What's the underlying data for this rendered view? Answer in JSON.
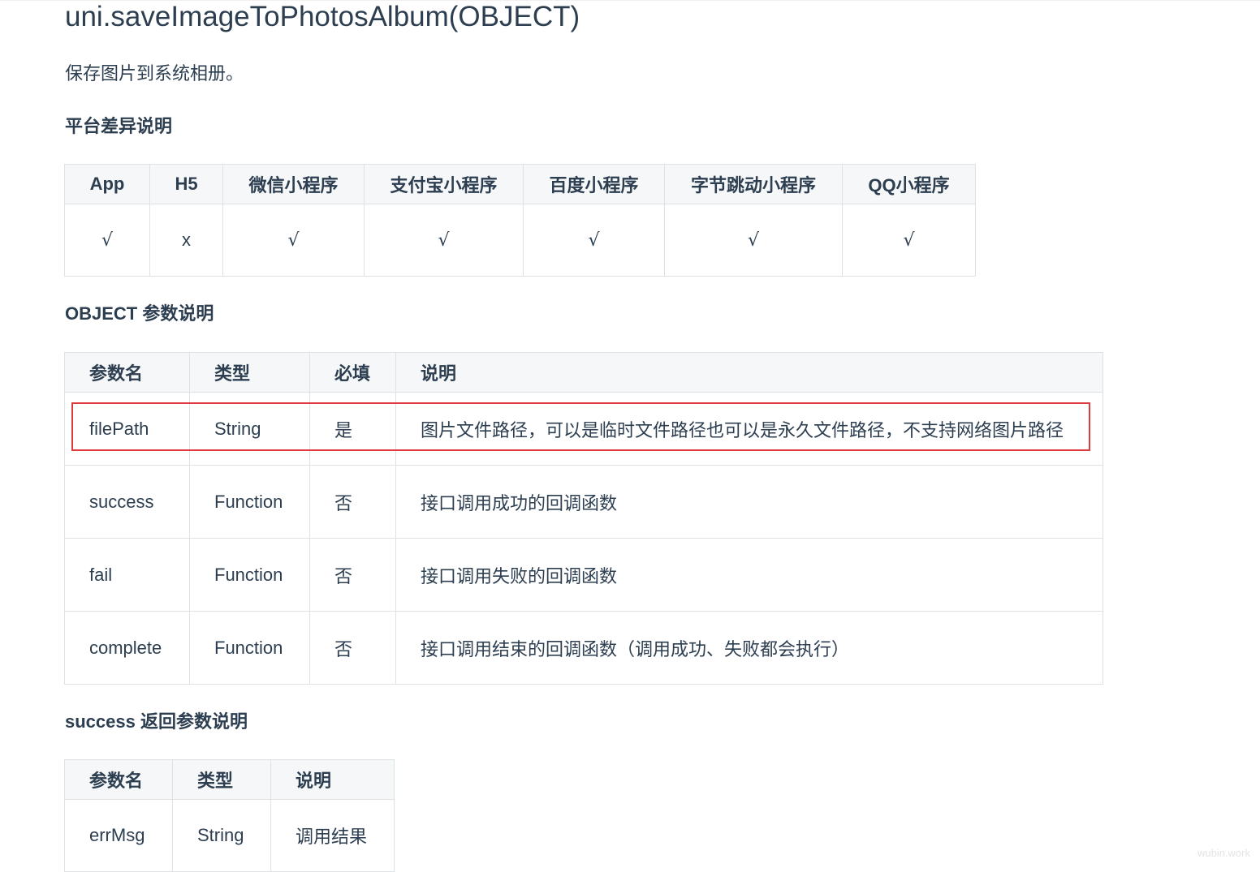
{
  "page": {
    "title": "uni.saveImageToPhotosAlbum(OBJECT)",
    "description": "保存图片到系统相册。"
  },
  "platform_section": {
    "heading": "平台差异说明",
    "columns": [
      "App",
      "H5",
      "微信小程序",
      "支付宝小程序",
      "百度小程序",
      "字节跳动小程序",
      "QQ小程序"
    ],
    "support": [
      "√",
      "x",
      "√",
      "√",
      "√",
      "√",
      "√"
    ]
  },
  "object_section": {
    "heading": "OBJECT 参数说明",
    "columns": [
      "参数名",
      "类型",
      "必填",
      "说明"
    ],
    "rows": [
      {
        "name": "filePath",
        "type": "String",
        "required": "是",
        "desc": "图片文件路径，可以是临时文件路径也可以是永久文件路径，不支持网络图片路径"
      },
      {
        "name": "success",
        "type": "Function",
        "required": "否",
        "desc": "接口调用成功的回调函数"
      },
      {
        "name": "fail",
        "type": "Function",
        "required": "否",
        "desc": "接口调用失败的回调函数"
      },
      {
        "name": "complete",
        "type": "Function",
        "required": "否",
        "desc": "接口调用结束的回调函数（调用成功、失败都会执行）"
      }
    ],
    "highlight_color": "#e0393e"
  },
  "success_section": {
    "heading": "success 返回参数说明",
    "columns": [
      "参数名",
      "类型",
      "说明"
    ],
    "rows": [
      {
        "name": "errMsg",
        "type": "String",
        "desc": "调用结果"
      }
    ]
  },
  "watermark": "wubin.work"
}
